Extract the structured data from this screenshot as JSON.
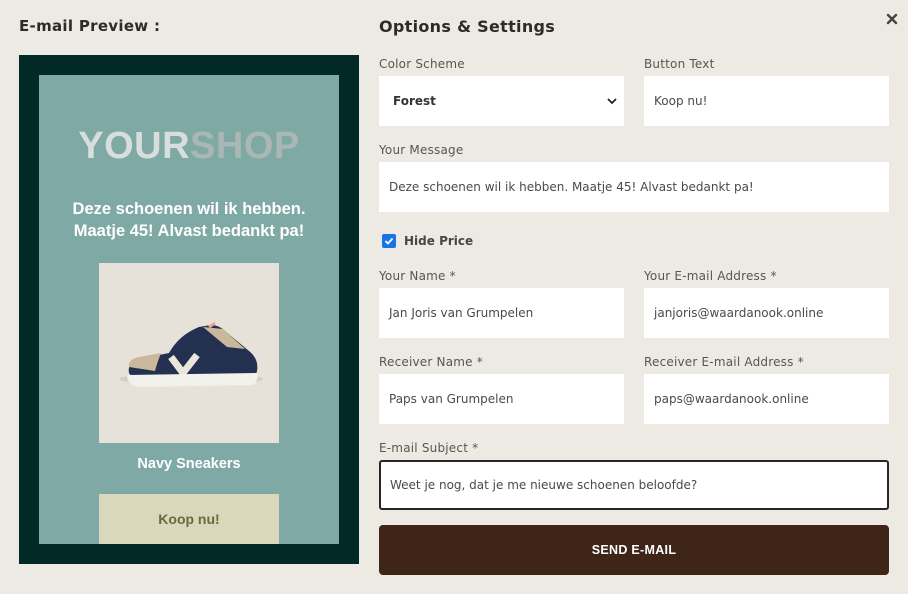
{
  "preview": {
    "heading": "E-mail Preview :",
    "logo_part1": "YOUR",
    "logo_part2": "SHOP",
    "message": "Deze schoenen wil ik hebben. Maatje 45! Alvast bedankt pa!",
    "product_name": "Navy Sneakers",
    "button_label": "Koop nu!",
    "colors": {
      "frame": "#012a26",
      "card": "#7fa9a5",
      "button": "#d9d8bc"
    }
  },
  "options": {
    "heading": "Options & Settings",
    "color_scheme": {
      "label": "Color Scheme",
      "value": "Forest"
    },
    "button_text": {
      "label": "Button Text",
      "value": "Koop nu!"
    },
    "message": {
      "label": "Your Message",
      "value": "Deze schoenen wil ik hebben. Maatje 45! Alvast bedankt pa!"
    },
    "hide_price": {
      "label": "Hide Price",
      "checked": true
    },
    "your_name": {
      "label": "Your Name *",
      "value": "Jan Joris van Grumpelen"
    },
    "your_email": {
      "label": "Your E-mail Address *",
      "value": "janjoris@waardanook.online"
    },
    "receiver_name": {
      "label": "Receiver Name *",
      "value": "Paps van Grumpelen"
    },
    "receiver_email": {
      "label": "Receiver E-mail Address *",
      "value": "paps@waardanook.online"
    },
    "subject": {
      "label": "E-mail Subject *",
      "value": "Weet je nog, dat je me nieuwe schoenen beloofde?"
    },
    "send_label": "SEND E-MAIL",
    "accent_color": "#3f2418"
  }
}
